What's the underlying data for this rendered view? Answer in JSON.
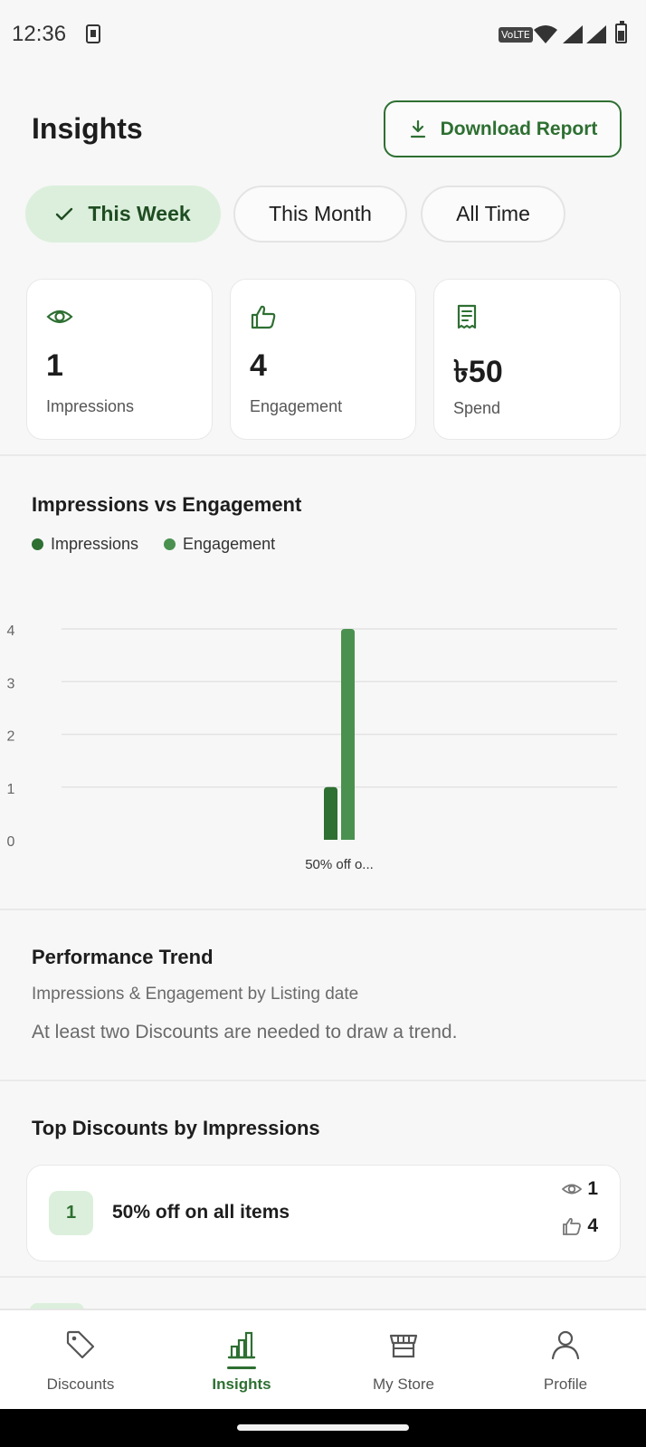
{
  "status": {
    "time": "12:36",
    "network": "VoLTE"
  },
  "header": {
    "title": "Insights",
    "download_label": "Download Report"
  },
  "tabs": [
    {
      "label": "This Week",
      "active": true
    },
    {
      "label": "This Month",
      "active": false
    },
    {
      "label": "All Time",
      "active": false
    }
  ],
  "stats": [
    {
      "icon": "eye-icon",
      "value": "1",
      "label": "Impressions"
    },
    {
      "icon": "thumbs-up-icon",
      "value": "4",
      "label": "Engagement"
    },
    {
      "icon": "receipt-icon",
      "value": "৳50",
      "label": "Spend"
    }
  ],
  "chart_section": {
    "title": "Impressions vs Engagement",
    "legend": [
      {
        "name": "Impressions",
        "color": "#2e6f32"
      },
      {
        "name": "Engagement",
        "color": "#4a9150"
      }
    ]
  },
  "chart_data": {
    "type": "bar",
    "categories": [
      "50% off o..."
    ],
    "series": [
      {
        "name": "Impressions",
        "values": [
          1
        ],
        "color": "#2e6f32"
      },
      {
        "name": "Engagement",
        "values": [
          4
        ],
        "color": "#4a9150"
      }
    ],
    "yticks": [
      "0",
      "1",
      "2",
      "3",
      "4"
    ],
    "ylim": [
      0,
      4
    ],
    "grid": true
  },
  "performance": {
    "title": "Performance Trend",
    "subtitle": "Impressions & Engagement by Listing date",
    "note": "At least two Discounts are needed to draw a trend."
  },
  "top_discounts": {
    "title": "Top Discounts by Impressions",
    "items": [
      {
        "rank": "1",
        "name": "50% off on all items",
        "impressions": "1",
        "engagement": "4"
      }
    ]
  },
  "nav": [
    {
      "label": "Discounts",
      "icon": "tag-icon",
      "active": false
    },
    {
      "label": "Insights",
      "icon": "bar-chart-icon",
      "active": true
    },
    {
      "label": "My Store",
      "icon": "store-icon",
      "active": false
    },
    {
      "label": "Profile",
      "icon": "person-icon",
      "active": false
    }
  ],
  "colors": {
    "accent": "#2e6f32",
    "accent_light": "#dcefdc",
    "engagement": "#4a9150"
  }
}
